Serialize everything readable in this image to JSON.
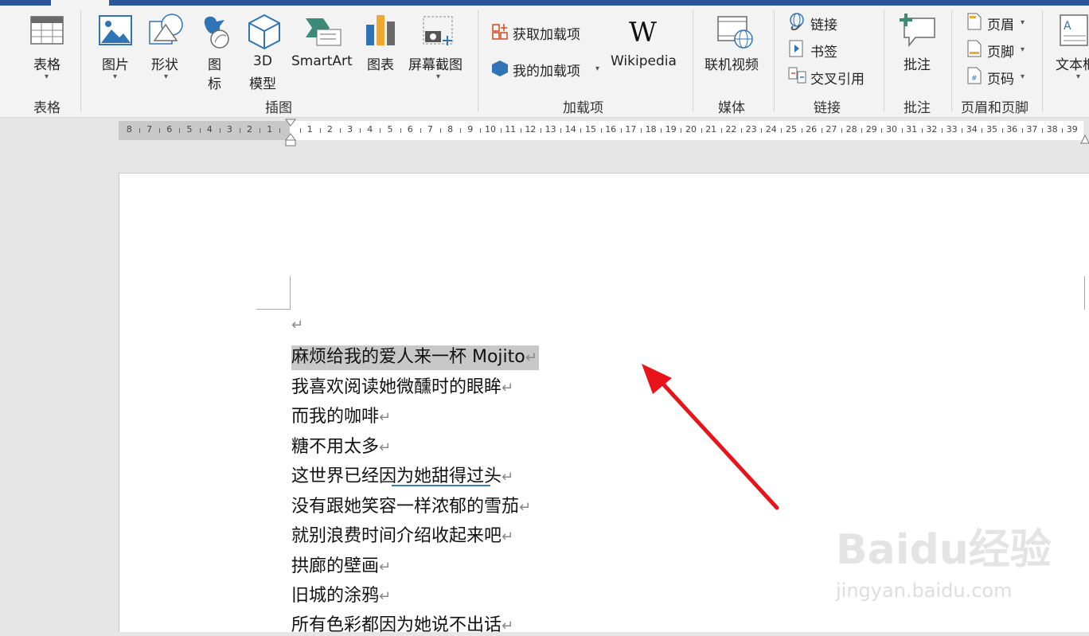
{
  "ribbon": {
    "table": {
      "label": "表格",
      "group": "表格"
    },
    "illustrations": {
      "picture": "图片",
      "shapes": "形状",
      "icons_line1": "图",
      "icons_line2": "标",
      "model3d_line1": "3D",
      "model3d_line2": "模型",
      "smartart": "SmartArt",
      "chart": "图表",
      "screenshot": "屏幕截图",
      "group": "插图"
    },
    "addins": {
      "get_addins": "获取加载项",
      "my_addins": "我的加载项",
      "wikipedia": "Wikipedia",
      "group": "加载项"
    },
    "media": {
      "online_video": "联机视频",
      "group": "媒体"
    },
    "links": {
      "link": "链接",
      "bookmark": "书签",
      "cross_ref": "交叉引用",
      "group": "链接"
    },
    "comments": {
      "comment": "批注",
      "group": "批注"
    },
    "header_footer": {
      "header": "页眉",
      "footer": "页脚",
      "page_number": "页码",
      "group": "页眉和页脚"
    },
    "text": {
      "textbox": "文本框"
    }
  },
  "ruler": {
    "left_numbers": [
      "8",
      "7",
      "6",
      "5",
      "4",
      "3",
      "2",
      "1"
    ],
    "right_numbers": [
      "1",
      "2",
      "3",
      "4",
      "5",
      "6",
      "7",
      "8",
      "9",
      "10",
      "11",
      "12",
      "13",
      "14",
      "15",
      "16",
      "17",
      "18",
      "19",
      "20",
      "21",
      "22",
      "23",
      "24",
      "25",
      "26",
      "27",
      "28",
      "29",
      "30",
      "31",
      "32",
      "33",
      "34",
      "35",
      "36",
      "37",
      "38",
      "39"
    ]
  },
  "document": {
    "paragraph_mark": "↵",
    "lines": [
      "麻烦给我的爱人来一杯 Mojito",
      "我喜欢阅读她微醺时的眼眸",
      "而我的咖啡",
      "糖不用太多",
      "这世界已经因为她甜得过头",
      "没有跟她笑容一样浓郁的雪茄",
      "就别浪费时间介绍收起来吧",
      "拱廊的壁画",
      "旧城的涂鸦",
      "所有色彩都因为她说不出话"
    ]
  },
  "watermark": {
    "brand": "Baidu经验",
    "url": "jingyan.baidu.com"
  },
  "colors": {
    "accent": "#2b579a",
    "arrow": "#e8141c",
    "selection": "#c8c8c8"
  }
}
